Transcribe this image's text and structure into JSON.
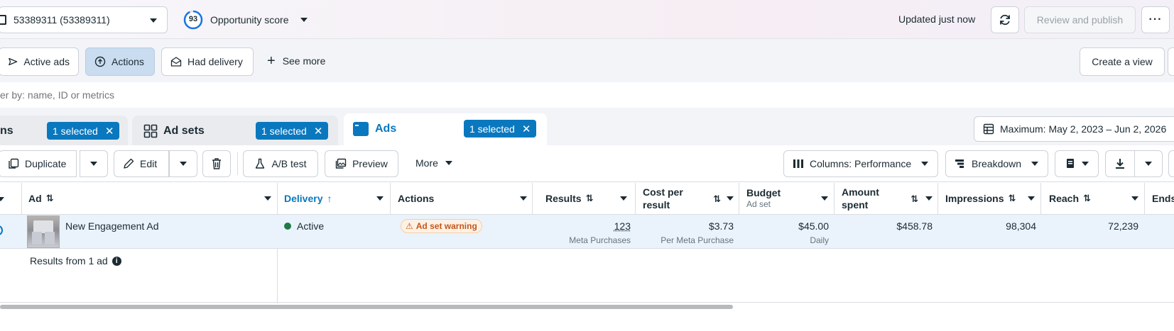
{
  "header": {
    "account_label": "53389311 (53389311)",
    "score_value": "93",
    "score_label": "Opportunity score",
    "updated_text": "Updated just now",
    "review_publish_label": "Review and publish"
  },
  "filters": {
    "active_ads_label": "Active ads",
    "actions_label": "Actions",
    "had_delivery_label": "Had delivery",
    "see_more_label": "See more",
    "create_view_label": "Create a view"
  },
  "search": {
    "placeholder": "er by: name, ID or metrics"
  },
  "level_tabs": {
    "campaigns": {
      "label": "ns",
      "selected": "1 selected"
    },
    "ad_sets": {
      "label": "Ad sets",
      "selected": "1 selected"
    },
    "ads": {
      "label": "Ads",
      "selected": "1 selected"
    },
    "date_range": "Maximum: May 2, 2023 – Jun 2, 2026"
  },
  "toolbar": {
    "duplicate_label": "Duplicate",
    "edit_label": "Edit",
    "ab_test_label": "A/B test",
    "preview_label": "Preview",
    "more_label": "More",
    "columns_label": "Columns: Performance",
    "breakdown_label": "Breakdown"
  },
  "table": {
    "headers": {
      "ad": "Ad",
      "delivery": "Delivery",
      "actions": "Actions",
      "results": "Results",
      "cost_per_result_1": "Cost per",
      "cost_per_result_2": "result",
      "budget": "Budget",
      "budget_sub": "Ad set",
      "amount_spent_1": "Amount",
      "amount_spent_2": "spent",
      "impressions": "Impressions",
      "reach": "Reach",
      "ends": "Ends"
    },
    "row": {
      "ad_name": "New Engagement Ad",
      "delivery": "Active",
      "warning": "Ad set warning",
      "results": "123",
      "results_sub": "Meta Purchases",
      "cost_per_result": "$3.73",
      "cost_per_result_sub": "Per Meta Purchase",
      "budget": "$45.00",
      "budget_sub": "Daily",
      "amount_spent": "$458.78",
      "impressions": "98,304",
      "reach": "72,239"
    },
    "footer": {
      "results_from": "Results from 1 ad"
    }
  },
  "colors": {
    "accent": "#0a78be",
    "active_green": "#1f7a4a",
    "warning_orange": "#c4561d"
  }
}
